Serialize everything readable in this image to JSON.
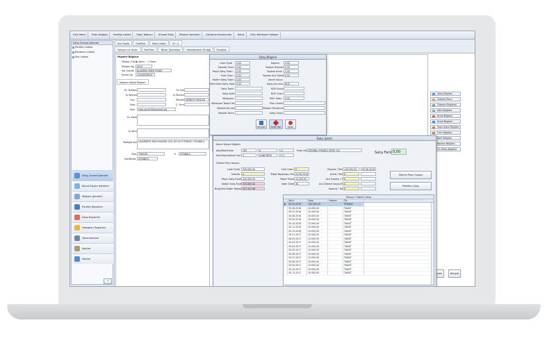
{
  "topbar": {
    "tabs": [
      "Hızlı Menü",
      "Proje Değişin",
      "Portföy Listesi",
      "Satış Tablosu",
      "Günsel Satış",
      "Müşteri İşlemleri",
      "Görüşme Randevular",
      "Rakor",
      "Ürün Bekleyen Satışlar"
    ]
  },
  "tabstrip2": [
    "Ana Sayfa",
    "Grafikler",
    "Satış Listesi",
    "KO-12"
  ],
  "tabstrip3": [
    "Satışlarınız Yazdır",
    "Kat Planı",
    "Tekrar Şartname",
    "Vekaletname Örneği",
    "Evraklar"
  ],
  "sidebar": {
    "header": "Satış Öncesi İşlemler",
    "items": [
      "Portföy Listesi",
      "Randevu Listesi",
      "Ses Listesi"
    ],
    "nav": [
      "Satış Öncesi İşlemler",
      "Konut Kişum İşlemleri",
      "Müşteri İşlemleri",
      "Portföy Raporları",
      "Satış Raporları",
      "Hesapları Raporları",
      "Tanımlamalar",
      "Ayarlar",
      "Yardım"
    ]
  },
  "customer": {
    "group_title": "Müşteri Bilgileri",
    "type_label": "Müşteri Tipi",
    "type_opt1": "Şahıs",
    "type_opt2": "Firma",
    "no_label": "Müşteri No",
    "no_value": "A012",
    "name_label": "Adı Soyadı",
    "name_value": "ALADDİN ÖMER YILDIZ",
    "id_label": "Kimlik No",
    "id_value": "12345678910",
    "contact_tab": "İletişim Kişisel Bilgileri",
    "phone_label": "Ev Telefonu",
    "work_label": "İş Telefonu",
    "mobile_label": "Cep",
    "fax_label": "Faks",
    "email_label": "Mail",
    "email_value": "aliza.gfuzly@alameed.org",
    "fax2_label": "Ev Faks",
    "workphone2_label": "İş Telefonu",
    "mediator_label": "Meslek",
    "mediator_value": "SERBEST MESLEK",
    "city_label": "Ç. Firma",
    "home_addr_label": "Ev Adresi",
    "work_addr_label": "İş Adresi",
    "notify_label": "Tebligat Adresi",
    "notify_value": "ÇINARDERE MAH HAKARA CAD. NO:4/73 PENDIK / İSTANBUL",
    "country_label": "Ülke",
    "country_value": "TÜRKİYE",
    "city2_label": "İl",
    "city2_value": "İSTANBUL",
    "birth_label": "İlçe/Belde",
    "birth_value": "İSTANBUL"
  },
  "sales_info": {
    "title": "Satış Bilgileri",
    "list_price_label": "Liste Fiyatı",
    "list_price": "0,00",
    "discount_label": "İskonto Oranı",
    "discount": "0,00",
    "peak_label": "Peşin Satış Tutarı",
    "peak": "0,00",
    "extra_label": "Fark Oranı",
    "extra": "0,00",
    "kdv_label": "Kadim Satış Tutarı",
    "kdv": "0,00",
    "kdv2_label": "KDV Dahil Satış Tutarı",
    "kdv2": "0,00",
    "deposit_label": "Kapora",
    "deposit": "0,00",
    "total_pay_label": "Toplam Peşinat",
    "total_pay": "0,00",
    "total_credit_label": "Toplam Kredi",
    "total_credit": "0,00",
    "installment_label": "Toplam Ara Ödeme",
    "installment": "0,00",
    "senet_label": "Senet Sayısı",
    "status_label": "Satış Durumu",
    "status": "BOŞ",
    "date_label": "Satış Tarihi",
    "type_label": "Satış Şekli",
    "source_label": "Sözleşme",
    "delivery_label": "Sözleşme Teslim Tarihi",
    "deliv_state_label": "Vekalet Durumu",
    "vek_date_label": "Vekalet Tarihi",
    "kdv_d_label": "KDV Durum",
    "kdv_rate_label": "KDV Oranı",
    "kdv_amount_label": "KDV Tutarı",
    "kdv_amount": "0,00",
    "flat_label": "Plan Linkleri",
    "note_label": "Müşteri Temsilcisi",
    "state_label": "Satış Onayı",
    "btn_save": "Kaydet",
    "btn_sale": "Satış Yap",
    "btn_cancel": "İptal"
  },
  "sales_proc": {
    "title": "Satış İşlemi",
    "group_label": "Konut Kişum Bilgileri",
    "block_label": "Ada/Blok/Daire",
    "block1": "162",
    "block2": "A",
    "block3": "12",
    "plan_label": "Kat/Cephe/Konut tipi",
    "plan1": "4",
    "plan2": "GUNEYBATI",
    "plan3": "3+1",
    "proj_label": "Proje Adı",
    "proj_value": "SEDDİNLİ PİYAKTLİ ERDE 125",
    "price_diff_label": "Satış Farkı",
    "price_diff": "0,00",
    "pay_group": "Ödeme Plan Hazırla",
    "list_price_label": "Liste Fiyatı",
    "list_price": "345.000,00",
    "discount_label": "İskonto",
    "discount": "0",
    "peak_label": "Peşin Satış Fiyatı",
    "peak": "345.000,00",
    "kdv_label": "Vadeli Satış Fiyatı",
    "kdv": "343.800,00",
    "today_label": "Bugünkü Değer Toplamı",
    "today": "223.341,86",
    "rate_label": "Fark Oranı",
    "rate": "0",
    "start_label": "Taksit Başlangıç Tarihi",
    "start": "05.06.2016",
    "total_label": "Taksit Tutarı",
    "total": "10.000,00",
    "period_label": "Vade Süresi",
    "period": "36",
    "payment_label": "Peşinat / Tarih",
    "payment": "140.000,00",
    "payment_date": "05.06.2016",
    "credit_label": "Kredi / Tarih",
    "credit": "0",
    "inter_label": "Ara Ödeme / Tarih",
    "inter": "0",
    "inter_count_label": "Ara Ödeme Sayısı/Yüzde",
    "inter_count": "0",
    "deposit_label": "Kapora / Tarih",
    "deposit": "0",
    "btn_plan": "Ödeme Planı Oluştur",
    "btn_print": "Pekliften Çıkış",
    "grid_title": "Ekrana 1 Satırlık çıktısı",
    "cols": [
      "Tarih",
      "Tutar",
      "Ödeme",
      "Tür"
    ],
    "rows": [
      [
        "05.05.2016",
        "140.000,00",
        "",
        "PEŞİNAT"
      ],
      [
        "30.06.2016",
        "10.000,00",
        "",
        "TAKSİT"
      ],
      [
        "30.07.2016",
        "10.000,00",
        "",
        "TAKSİT"
      ],
      [
        "30.08.2016",
        "10.000,00",
        "",
        "TAKSİT"
      ],
      [
        "30.09.2016",
        "10.000,00",
        "",
        "TAKSİT"
      ],
      [
        "30.10.2016",
        "10.000,00",
        "",
        "TAKSİT"
      ],
      [
        "30.11.2016",
        "10.000,00",
        "",
        "TAKSİT"
      ],
      [
        "30.12.2016",
        "10.000,00",
        "",
        "TAKSİT"
      ],
      [
        "30.01.2017",
        "10.000,00",
        "",
        "TAKSİT"
      ],
      [
        "28.02.2017",
        "10.000,00",
        "",
        "TAKSİT"
      ],
      [
        "30.03.2017",
        "10.000,00",
        "",
        "TAKSİT"
      ],
      [
        "30.04.2017",
        "10.000,00",
        "",
        "TAKSİT"
      ],
      [
        "30.05.2017",
        "10.000,00",
        "",
        "TAKSİT"
      ],
      [
        "30.06.2017",
        "10.000,00",
        "",
        "TAKSİT"
      ],
      [
        "30.07.2017",
        "10.000,00",
        "",
        "TAKSİT"
      ],
      [
        "30.08.2017",
        "10.000,00",
        "",
        "TAKSİT"
      ],
      [
        "30.09.2017",
        "10.000,00",
        "",
        "TAKSİT"
      ],
      [
        "30.10.2017",
        "10.000,00",
        "",
        "TAKSİT"
      ],
      [
        "30.11.2017",
        "10.000,00",
        "",
        "TAKSİT"
      ]
    ]
  },
  "right_panel": [
    "Satış Bilgileri",
    "Ödeme Planı",
    "Ödeme Bilgilemi",
    "Kötü Bilgileri",
    "Kredi Bilgileri",
    "Kredi Bilgileri",
    "Tapu İşlem Bilgileri",
    "Fırın Bilgileri",
    "Kerli Bilgileri",
    "Banker Bilgileri",
    "Ön Talep Bilgileri"
  ],
  "right_bottom": {
    "save": "Kaydet",
    "close": "Kapat"
  }
}
